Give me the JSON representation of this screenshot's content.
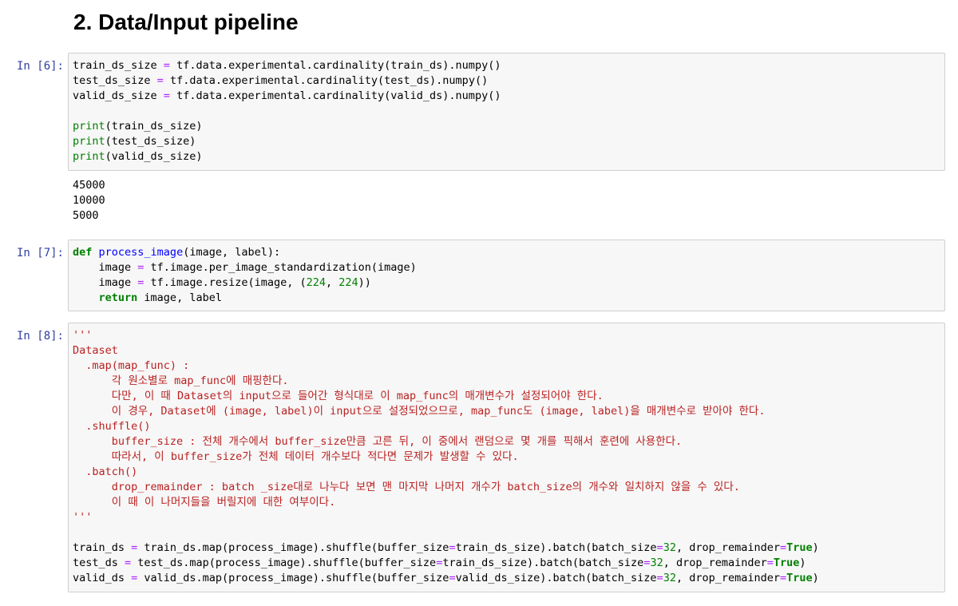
{
  "heading": "2. Data/Input pipeline",
  "cells": [
    {
      "prompt": "In [6]:",
      "code": [
        "train_ds_size = tf.data.experimental.cardinality(train_ds).numpy()",
        "test_ds_size = tf.data.experimental.cardinality(test_ds).numpy()",
        "valid_ds_size = tf.data.experimental.cardinality(valid_ds).numpy()",
        "",
        "print(train_ds_size)",
        "print(test_ds_size)",
        "print(valid_ds_size)"
      ],
      "output": [
        "45000",
        "10000",
        "5000"
      ]
    },
    {
      "prompt": "In [7]:",
      "code": [
        "def process_image(image, label):",
        "    image = tf.image.per_image_standardization(image)",
        "    image = tf.image.resize(image, (224, 224))",
        "    return image, label"
      ],
      "output": []
    },
    {
      "prompt": "In [8]:",
      "code": [
        "'''",
        "Dataset",
        "  .map(map_func) :",
        "      각 원소별로 map_func에 매핑한다.",
        "      다만, 이 때 Dataset의 input으로 들어간 형식대로 이 map_func의 매개변수가 설정되어야 한다.",
        "      이 경우, Dataset에 (image, label)이 input으로 설정되었으므로, map_func도 (image, label)을 매개변수로 받아야 한다.",
        "  .shuffle()",
        "      buffer_size : 전체 개수에서 buffer_size만큼 고른 뒤, 이 중에서 랜덤으로 몇 개를 픽해서 훈련에 사용한다.",
        "      따라서, 이 buffer_size가 전체 데이터 개수보다 적다면 문제가 발생할 수 있다.",
        "  .batch()",
        "      drop_remainder : batch _size대로 나누다 보면 맨 마지막 나머지 개수가 batch_size의 개수와 일치하지 않을 수 있다.",
        "      이 때 이 나머지들을 버릴지에 대한 여부이다.",
        "'''",
        "",
        "train_ds = train_ds.map(process_image).shuffle(buffer_size=train_ds_size).batch(batch_size=32, drop_remainder=True)",
        "test_ds = test_ds.map(process_image).shuffle(buffer_size=train_ds_size).batch(batch_size=32, drop_remainder=True)",
        "valid_ds = valid_ds.map(process_image).shuffle(buffer_size=valid_ds_size).batch(batch_size=32, drop_remainder=True)"
      ],
      "output": []
    }
  ]
}
